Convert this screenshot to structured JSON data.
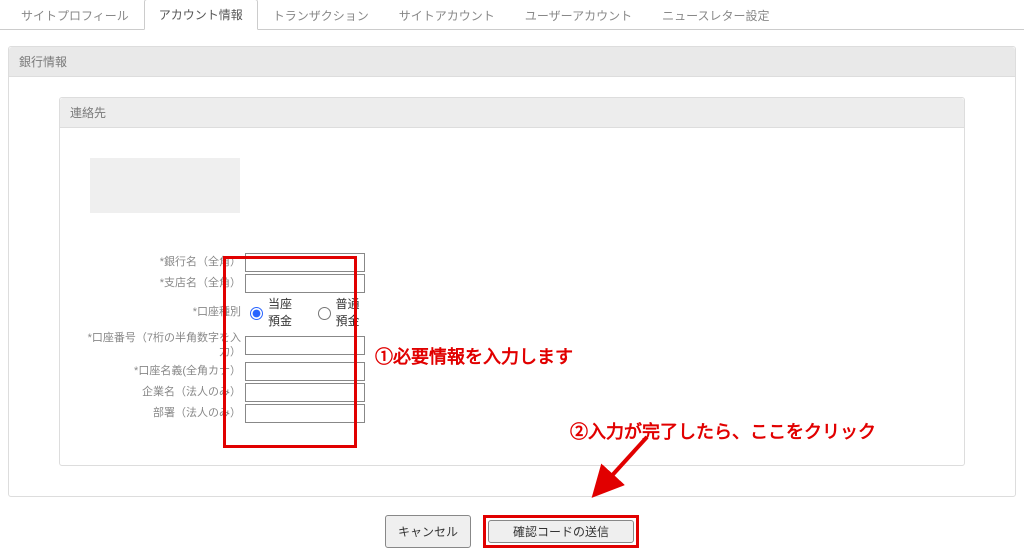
{
  "tabs": {
    "site_profile": "サイトプロフィール",
    "account_info": "アカウント情報",
    "transactions": "トランザクション",
    "site_account": "サイトアカウント",
    "user_account": "ユーザーアカウント",
    "newsletter": "ニュースレター設定"
  },
  "panel": {
    "title": "銀行情報",
    "sub_title": "連絡先"
  },
  "form": {
    "bank_name_label": "*銀行名（全角）",
    "branch_name_label": "*支店名（全角）",
    "account_type_label": "*口座種別",
    "account_type_option_checking": "当座預金",
    "account_type_option_savings": "普通預金",
    "account_number_label": "*口座番号（7桁の半角数字を入力）",
    "account_holder_label": "*口座名義(全角カナ）",
    "company_name_label": "企業名（法人のみ）",
    "department_label": "部署（法人のみ）",
    "bank_name_value": "",
    "branch_name_value": "",
    "account_number_value": "",
    "account_holder_value": "",
    "company_name_value": "",
    "department_value": ""
  },
  "buttons": {
    "cancel": "キャンセル",
    "send_code": "確認コードの送信"
  },
  "annotations": {
    "step1": "①必要情報を入力します",
    "step2": "②入力が完了したら、ここをクリック",
    "highlight_color": "#E10000"
  }
}
